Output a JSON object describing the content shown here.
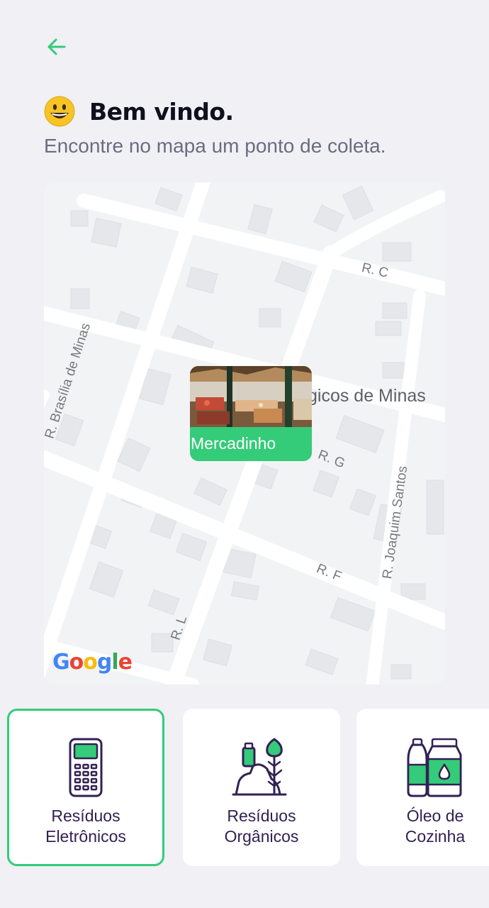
{
  "header": {
    "back_icon": "arrow-left-icon",
    "emoji_icon": "smiling-face-icon",
    "title": "Bem vindo.",
    "subtitle": "Encontre no mapa um ponto de coleta."
  },
  "map": {
    "street_labels": [
      "R. C",
      "R. Brasília de Minas",
      "R. G",
      "R. F",
      "R. L",
      "R. Joaquim Santos"
    ],
    "poi_label": "gicos de Minas",
    "attribution": [
      "G",
      "o",
      "o",
      "g",
      "l",
      "e"
    ],
    "marker": {
      "label": "Mercadinho",
      "image": "market-stall-photo"
    }
  },
  "items": [
    {
      "label_line1": "Resíduos",
      "label_line2": "Eletrônicos",
      "icon": "electronic-device-icon",
      "selected": true
    },
    {
      "label_line1": "Resíduos",
      "label_line2": "Orgânicos",
      "icon": "organic-waste-icon",
      "selected": false
    },
    {
      "label_line1": "Óleo de",
      "label_line2": "Cozinha",
      "icon": "cooking-oil-icon",
      "selected": false
    }
  ],
  "colors": {
    "accent": "#34cb79",
    "title": "#0f0f1e",
    "subtitle": "#6c6c80",
    "item_text": "#322153",
    "background": "#f0f0f5"
  }
}
